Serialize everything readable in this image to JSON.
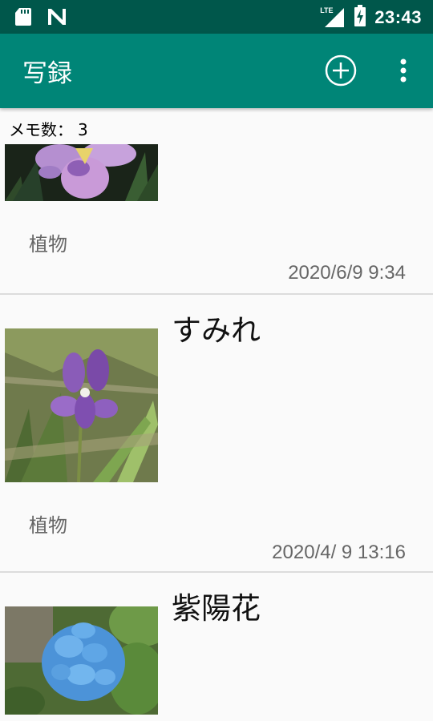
{
  "status_bar": {
    "time": "23:43",
    "network_label": "LTE",
    "icons": [
      "sd-card-icon",
      "notification-n-icon",
      "signal-icon",
      "battery-charging-icon"
    ]
  },
  "app_bar": {
    "title": "写録",
    "add_icon": "add-circle-icon",
    "menu_icon": "more-vert-icon"
  },
  "memo_count": {
    "label": "メモ数：",
    "value": "3"
  },
  "memos": [
    {
      "title": "",
      "category": "植物",
      "date": "2020/6/9 9:34",
      "image": "iris-flower-photo"
    },
    {
      "title": "すみれ",
      "category": "植物",
      "date": "2020/4/ 9  13:16",
      "image": "violet-flower-photo"
    },
    {
      "title": "紫陽花",
      "category": "",
      "date": "",
      "image": "hydrangea-flower-photo"
    }
  ],
  "colors": {
    "status_bar": "#00574b",
    "app_bar": "#008577",
    "background": "#fafafa",
    "divider": "#dcdcdc"
  }
}
